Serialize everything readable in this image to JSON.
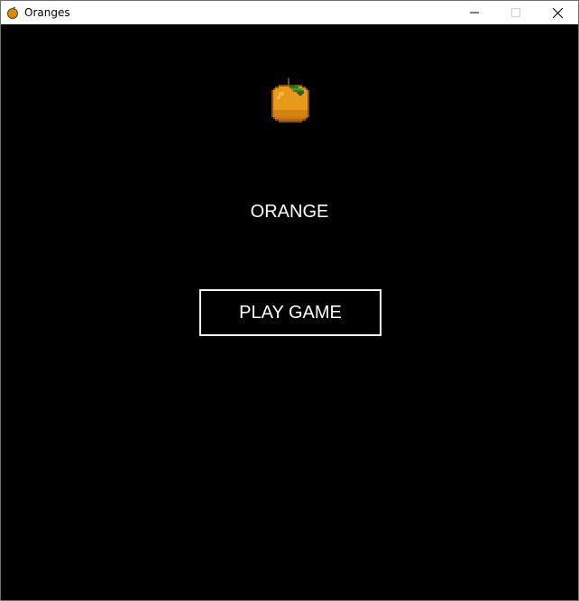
{
  "window": {
    "title": "Oranges",
    "app_icon": "orange-icon",
    "controls": {
      "minimize_icon": "minimize-icon",
      "maximize_icon": "maximize-icon",
      "close_icon": "close-icon"
    }
  },
  "game": {
    "sprite_icon": "orange-sprite-icon",
    "title": "ORANGE",
    "play_button_label": "PLAY GAME"
  },
  "colors": {
    "background": "#000000",
    "text": "#ffffff",
    "orange": "#e89a1c",
    "leaf": "#3a7a1f"
  }
}
